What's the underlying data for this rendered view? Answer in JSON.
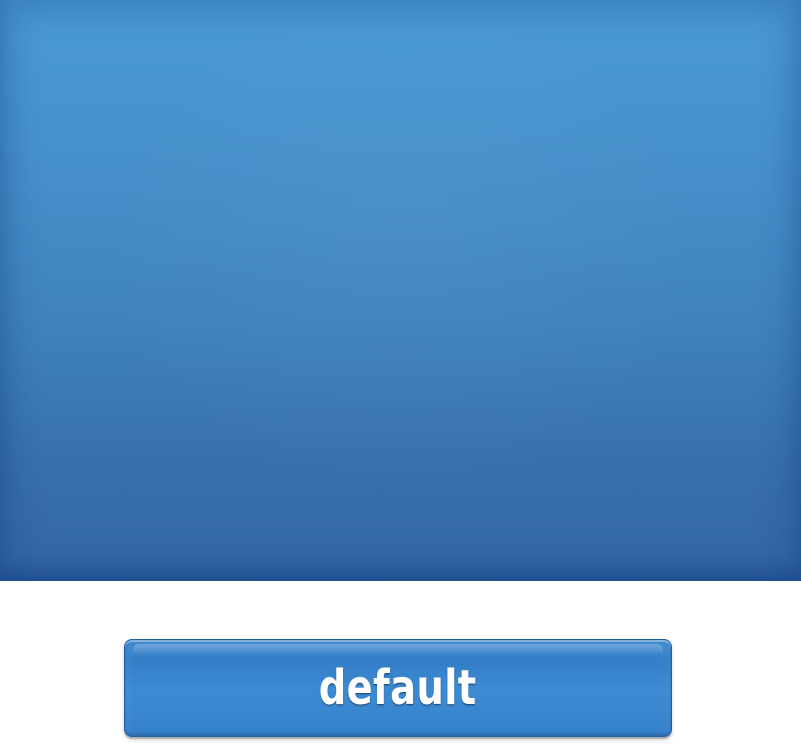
{
  "button": {
    "label": "default"
  },
  "colors": {
    "panel_top": "#4a9ad6",
    "panel_bottom": "#3366a6",
    "button_fill": "#3a87d0",
    "button_border": "#1f5ea7",
    "label": "#ffffff"
  }
}
